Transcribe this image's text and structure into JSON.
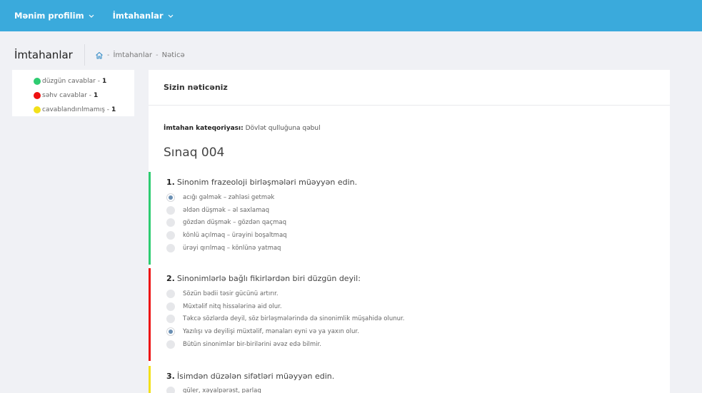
{
  "nav": {
    "profile": "Mənim profilim",
    "exams": "İmtahanlar"
  },
  "page": {
    "title": "İmtahanlar",
    "breadcrumb": [
      "İmtahanlar",
      "Nəticə"
    ]
  },
  "legend": [
    {
      "label": "düzgün cavablar -",
      "count": "1",
      "color": "#2ecc71"
    },
    {
      "label": "səhv cavablar -",
      "count": "1",
      "color": "#ee1111"
    },
    {
      "label": "cavablandırılmamış -",
      "count": "1",
      "color": "#f2e01a"
    }
  ],
  "result": {
    "heading": "Sizin nəticəniz",
    "category_label": "İmtahan kateqoriyası:",
    "category_value": "Dövlət qulluğuna qəbul",
    "exam_name": "Sınaq 004"
  },
  "questions": [
    {
      "number": "1.",
      "text": "Sinonim frazeoloji birləşmələri müəyyən edin.",
      "status_color": "#2ecc71",
      "options": [
        {
          "text": "acığı gəlmək – zəhləsi getmək",
          "selected": true
        },
        {
          "text": "əldən düşmək – əl saxlamaq",
          "selected": false
        },
        {
          "text": "gözdən düşmək – gözdən qaçmaq",
          "selected": false
        },
        {
          "text": "könlü açılmaq – ürəyini boşaltmaq",
          "selected": false
        },
        {
          "text": "ürəyi qırılmaq – könlünə yatmaq",
          "selected": false
        }
      ]
    },
    {
      "number": "2.",
      "text": "Sinonimlərlə bağlı fikirlərdən biri düzgün deyil:",
      "status_color": "#ee1111",
      "options": [
        {
          "text": "Sözün bədii təsir gücünü artırır.",
          "selected": false
        },
        {
          "text": "Müxtəlif nitq hissələrinə aid olur.",
          "selected": false
        },
        {
          "text": "Təkcə sözlərdə deyil, söz birləşmələrində də sinonimlik müşahidə olunur.",
          "selected": false
        },
        {
          "text": "Yazılışı və deyilişi müxtəlif, mənaları eyni və ya yaxın olur.",
          "selected": true
        },
        {
          "text": "Bütün sinonimlər bir-birilərini əvəz edə bilmir.",
          "selected": false
        }
      ]
    },
    {
      "number": "3.",
      "text": "İsimdən düzələn sifətləri müəyyən edin.",
      "status_color": "#f2e01a",
      "options": [
        {
          "text": "güler, xəyalpərəst, parlaq",
          "selected": false
        }
      ]
    }
  ]
}
